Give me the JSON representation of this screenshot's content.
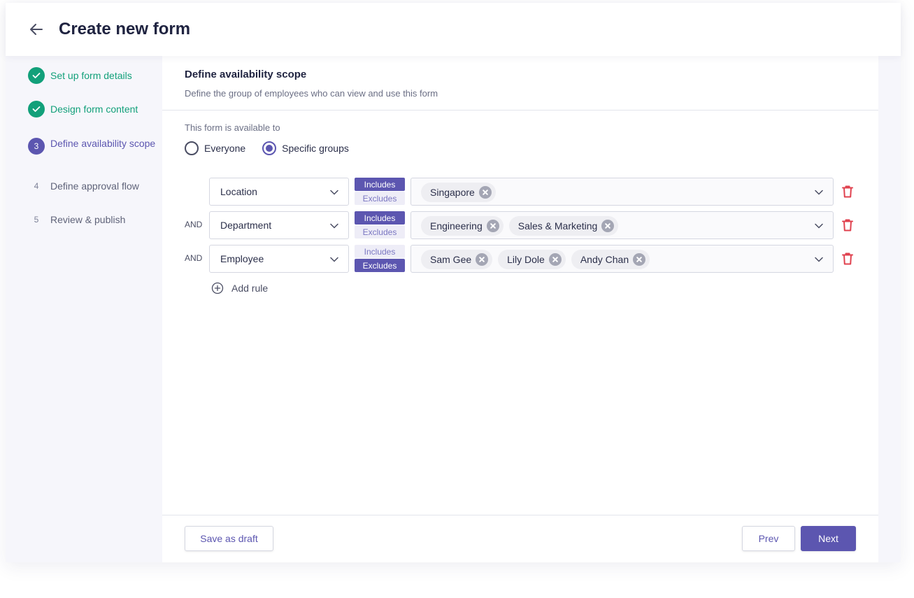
{
  "header": {
    "title": "Create new form"
  },
  "stepper": {
    "steps": [
      {
        "label": "Set up form details",
        "status": "done",
        "number": ""
      },
      {
        "label": "Design form content",
        "status": "done",
        "number": ""
      },
      {
        "label": "Define availability scope",
        "status": "active",
        "number": "3"
      },
      {
        "label": "Define approval flow",
        "status": "todo",
        "number": "4"
      },
      {
        "label": "Review & publish",
        "status": "todo",
        "number": "5"
      }
    ]
  },
  "section": {
    "title": "Define availability scope",
    "subtitle": "Define the group of employees who can view and use this form"
  },
  "availability": {
    "label": "This form is available to",
    "options": [
      {
        "label": "Everyone",
        "checked": false
      },
      {
        "label": "Specific groups",
        "checked": true
      }
    ]
  },
  "rules": [
    {
      "connector": "",
      "field": "Location",
      "includes_label": "Includes",
      "excludes_label": "Excludes",
      "mode": "includes",
      "values": [
        "Singapore"
      ]
    },
    {
      "connector": "AND",
      "field": "Department",
      "includes_label": "Includes",
      "excludes_label": "Excludes",
      "mode": "includes",
      "values": [
        "Engineering",
        "Sales & Marketing"
      ]
    },
    {
      "connector": "AND",
      "field": "Employee",
      "includes_label": "Includes",
      "excludes_label": "Excludes",
      "mode": "excludes",
      "values": [
        "Sam Gee",
        "Lily Dole",
        "Andy Chan"
      ]
    }
  ],
  "add_rule_label": "Add rule",
  "footer": {
    "draft_label": "Save as draft",
    "prev_label": "Prev",
    "next_label": "Next"
  },
  "colors": {
    "accent": "#5c56b0",
    "success": "#12a07a",
    "danger": "#e0424f"
  }
}
